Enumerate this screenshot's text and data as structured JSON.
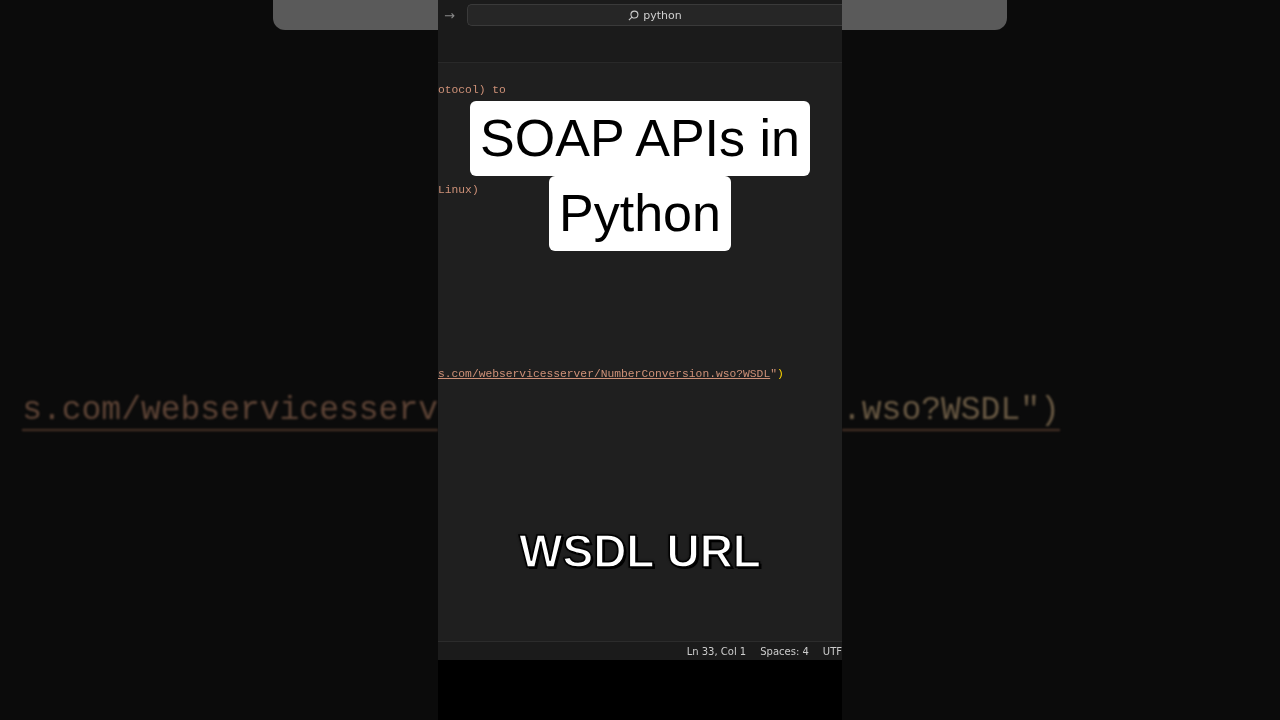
{
  "backdrop": {
    "left_text": "s.com/webservicesserv",
    "right_text": ".wso?WSDL\")"
  },
  "title_bar": {
    "nav_arrow": "→",
    "search": {
      "value": "python"
    }
  },
  "editor": {
    "lines": [
      {
        "segments": [
          {
            "kind": "string",
            "text": "otocol) to"
          }
        ]
      },
      {
        "segments": [
          {
            "kind": "string",
            "text": "Linux)"
          }
        ]
      },
      {
        "segments": [
          {
            "kind": "link",
            "text": "s.com/webservicesserver/NumberConversion.wso?WSDL"
          },
          {
            "kind": "string",
            "text": "\""
          },
          {
            "kind": "bracket",
            "text": ")"
          }
        ]
      }
    ]
  },
  "captions": {
    "title_lines": [
      "SOAP APIs in",
      "Python"
    ],
    "subtitle": "WSDL URL"
  },
  "status_bar": {
    "items": [
      "Ln 33, Col 1",
      "Spaces: 4",
      "UTF"
    ]
  }
}
